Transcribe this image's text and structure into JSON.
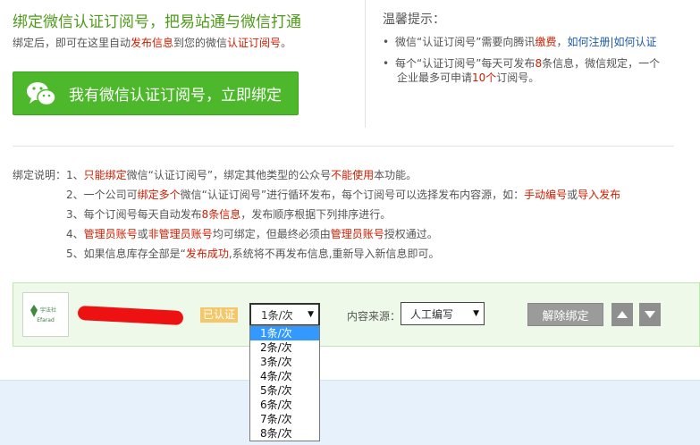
{
  "header": {
    "title": "绑定微信认证订阅号，把易站通与微信打通",
    "subline_pre": "绑定后，即可在这里自动",
    "subline_hl1": "发布信息",
    "subline_mid": "到您的微信",
    "subline_hl2": "认证订阅号",
    "subline_post": "。",
    "bind_button": "我有微信认证订阅号，立即绑定"
  },
  "tips": {
    "title": "温馨提示：",
    "item1_pre": "微信“认证订阅号”需要向腾讯",
    "item1_red": "缴费",
    "item1_sep": "，",
    "item1_link1": "如何注册",
    "item1_bar": "|",
    "item1_link2": "如何认证",
    "item2_pre": "每个“认证订阅号”每天可发布",
    "item2_red1": "8",
    "item2_mid": "条信息，微信规定，一个",
    "item2_line2_pre": "企业最多可申请",
    "item2_red2": "10个",
    "item2_post": "订阅号。"
  },
  "explain": {
    "l1_pre": "绑定说明：1、",
    "l1_red1": "只能绑定",
    "l1_mid": "微信“认证订阅号”，绑定其他类型的公众号",
    "l1_red2": "不能使用",
    "l1_post": "本功能。",
    "l2_pre": "2、一个公司可",
    "l2_red1": "绑定多个",
    "l2_mid": "微信“认证订阅号”进行循环发布，每个订阅号可以选择发布内容源，如：",
    "l2_red2": "手动编号",
    "l2_or": "或",
    "l2_red3": "导入发布",
    "l3_pre": "3、每个订阅号每天自动发布",
    "l3_red": "8条信息",
    "l3_post": "，发布顺序根据下列排序进行。",
    "l4_pre": "4、",
    "l4_red1": "管理员账号",
    "l4_or": "或",
    "l4_red2": "非管理员账号",
    "l4_mid": "均可绑定，但最终必须由",
    "l4_red3": "管理员账号",
    "l4_post": "授权通过。",
    "l5_pre": "5、如果信息库存全部是“",
    "l5_red": "发布成功",
    "l5_post": ",系统将不再发布信息,重新导入新信息即可。"
  },
  "account": {
    "logo_text": "宇法社",
    "logo_sub": "Efarad",
    "badge": "已认证",
    "count_selected": "1条/次",
    "source_label": "内容来源：",
    "source_selected": "人工编写",
    "unbind_button": "解除绑定"
  },
  "dropdown": {
    "options": [
      "1条/次",
      "2条/次",
      "3条/次",
      "4条/次",
      "5条/次",
      "6条/次",
      "7条/次",
      "8条/次"
    ]
  },
  "colors": {
    "accent_green": "#4eb82c",
    "title_green": "#4e9b1a",
    "highlight_red": "#cc1e00",
    "link_blue": "#1f5aa6",
    "badge": "#f3c86b",
    "selected_option": "#3399ff"
  }
}
